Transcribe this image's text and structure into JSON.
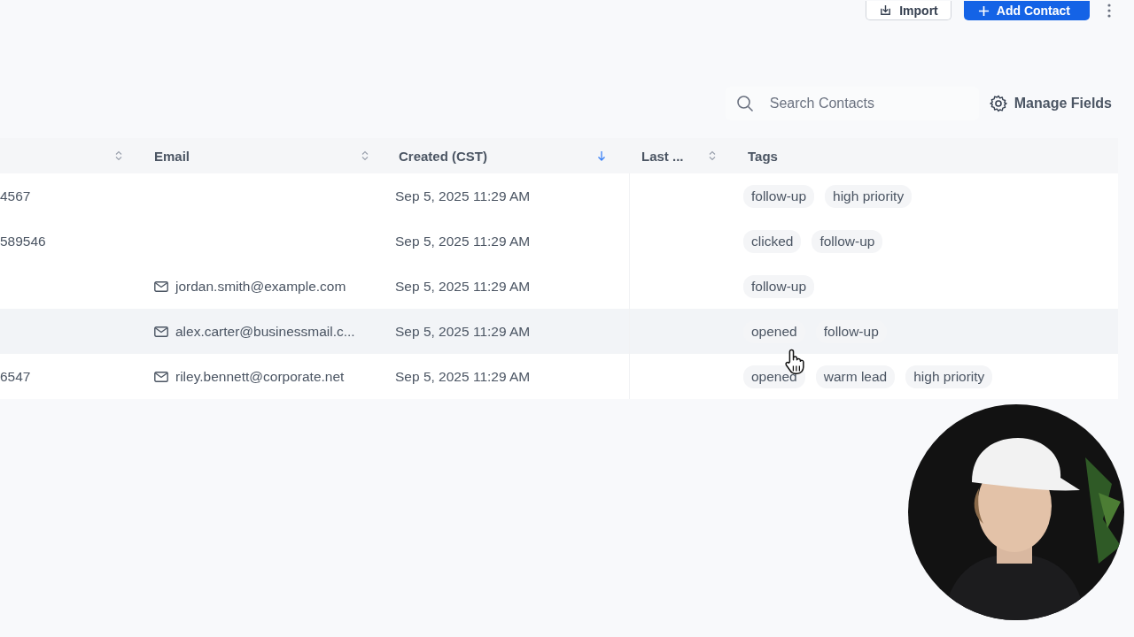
{
  "header": {
    "buttons": [
      {
        "label": "Import",
        "kind": "outline"
      },
      {
        "label": "Add Contact",
        "kind": "primary"
      }
    ]
  },
  "toolbar": {
    "search": {
      "placeholder": "Search Contacts"
    },
    "manage_fields": "Manage Fields"
  },
  "table": {
    "columns": [
      {
        "sorted": false
      },
      {
        "label": "Email",
        "sorted": false
      },
      {
        "label": "Created (CST)",
        "sorted": true
      },
      {
        "label": "Last ...",
        "sorted": false
      },
      {
        "label": "Tags"
      }
    ],
    "rows": [
      {
        "column_1": "4567",
        "created": "Sep 5, 2025 11:29 AM",
        "tags": [
          "follow-up",
          "high priority"
        ],
        "highlighted": false
      },
      {
        "column_1": "589546",
        "created": "Sep 5, 2025 11:29 AM",
        "tags": [
          "clicked",
          "follow-up"
        ],
        "highlighted": false
      },
      {
        "email": "jordan.smith@example.com",
        "created": "Sep 5, 2025 11:29 AM",
        "tags": [
          "follow-up"
        ],
        "highlighted": false
      },
      {
        "email": "alex.carter@businessmail.c...",
        "created": "Sep 5, 2025 11:29 AM",
        "tags": [
          "opened",
          "follow-up"
        ],
        "highlighted": true
      },
      {
        "column_1": "6547",
        "email": "riley.bennett@corporate.net",
        "created": "Sep 5, 2025 11:29 AM",
        "tags": [
          "opened",
          "warm lead",
          "high priority"
        ],
        "highlighted": false
      }
    ]
  }
}
